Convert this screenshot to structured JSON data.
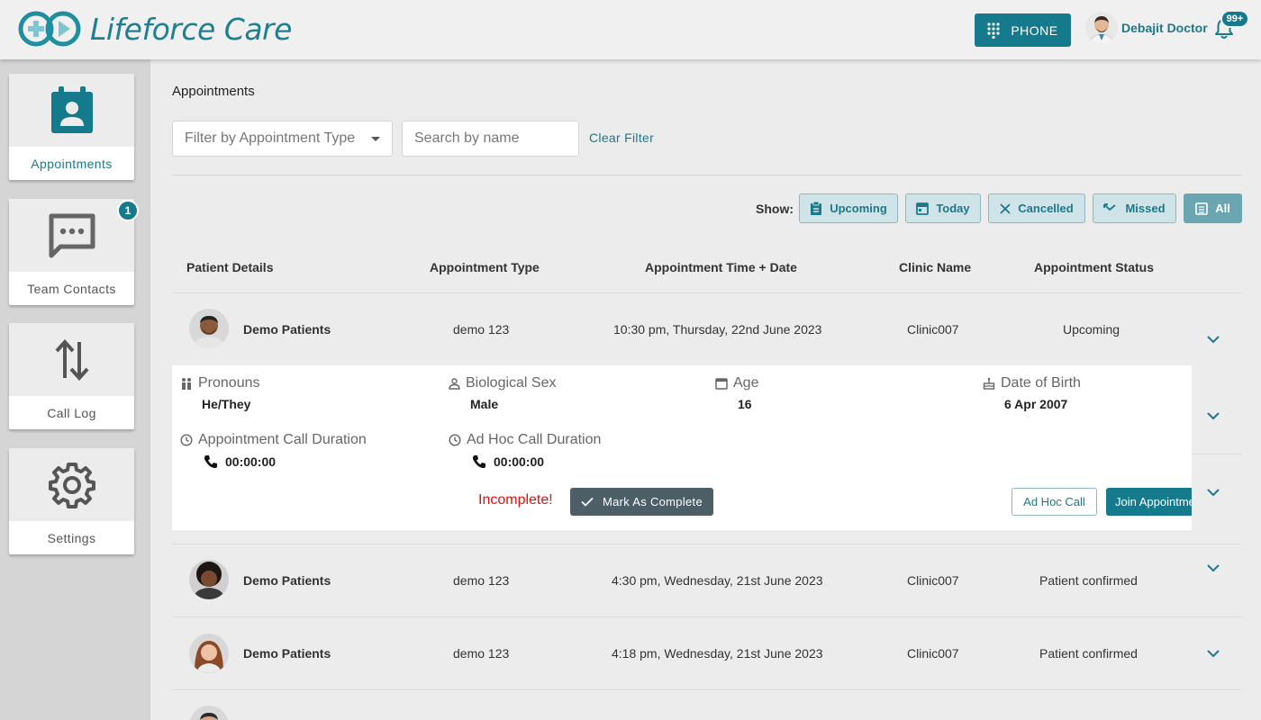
{
  "app": {
    "name": "Lifeforce Care"
  },
  "header": {
    "phone_label": "PHONE",
    "user_name": "Debajit Doctor",
    "notification_count": "99+"
  },
  "sidebar": {
    "items": [
      {
        "label": "Appointments",
        "icon": "calendar-person-icon",
        "active": true
      },
      {
        "label": "Team Contacts",
        "icon": "chat-bubble-icon",
        "badge": "1"
      },
      {
        "label": "Call Log",
        "icon": "arrows-up-down-icon"
      },
      {
        "label": "Settings",
        "icon": "gear-icon"
      }
    ]
  },
  "main": {
    "title": "Appointments",
    "filter_placeholder": "Filter by Appointment Type",
    "search_placeholder": "Search by name",
    "clear_filter": "Clear Filter",
    "show_label": "Show:",
    "show_buttons": [
      {
        "label": "Upcoming",
        "icon": "clipboard-icon"
      },
      {
        "label": "Today",
        "icon": "calendar-icon"
      },
      {
        "label": "Cancelled",
        "icon": "x-icon"
      },
      {
        "label": "Missed",
        "icon": "missed-arrow-icon"
      },
      {
        "label": "All",
        "icon": "list-icon",
        "active": true
      }
    ],
    "columns": [
      "Patient Details",
      "Appointment Type",
      "Appointment Time + Date",
      "Clinic Name",
      "Appointment Status"
    ],
    "rows": [
      {
        "name": "Demo Patients",
        "type": "demo 123",
        "time": "10:30 pm, Thursday, 22nd June 2023",
        "clinic": "Clinic007",
        "status": "Upcoming"
      },
      {
        "name": "Demo Patients",
        "type": "demo 123",
        "time": "4:30 pm, Wednesday, 21st June 2023",
        "clinic": "Clinic007",
        "status": "Patient confirmed"
      },
      {
        "name": "Demo Patients",
        "type": "demo 123",
        "time": "4:18 pm, Wednesday, 21st June 2023",
        "clinic": "Clinic007",
        "status": "Patient confirmed"
      }
    ],
    "detail": {
      "pronouns_label": "Pronouns",
      "pronouns": "He/They",
      "sex_label": "Biological Sex",
      "sex": "Male",
      "age_label": "Age",
      "age": "16",
      "dob_label": "Date of Birth",
      "dob": "6 Apr 2007",
      "appt_duration_label": "Appointment Call Duration",
      "appt_duration": "00:00:00",
      "adhoc_duration_label": "Ad Hoc Call Duration",
      "adhoc_duration": "00:00:00",
      "incomplete": "Incomplete!",
      "mark_complete": "Mark As Complete",
      "adhoc_call": "Ad Hoc Call",
      "join": "Join Appointment"
    }
  },
  "colors": {
    "brand": "#147a8c",
    "accent_light": "#cfe4e8",
    "danger": "#e01010"
  }
}
